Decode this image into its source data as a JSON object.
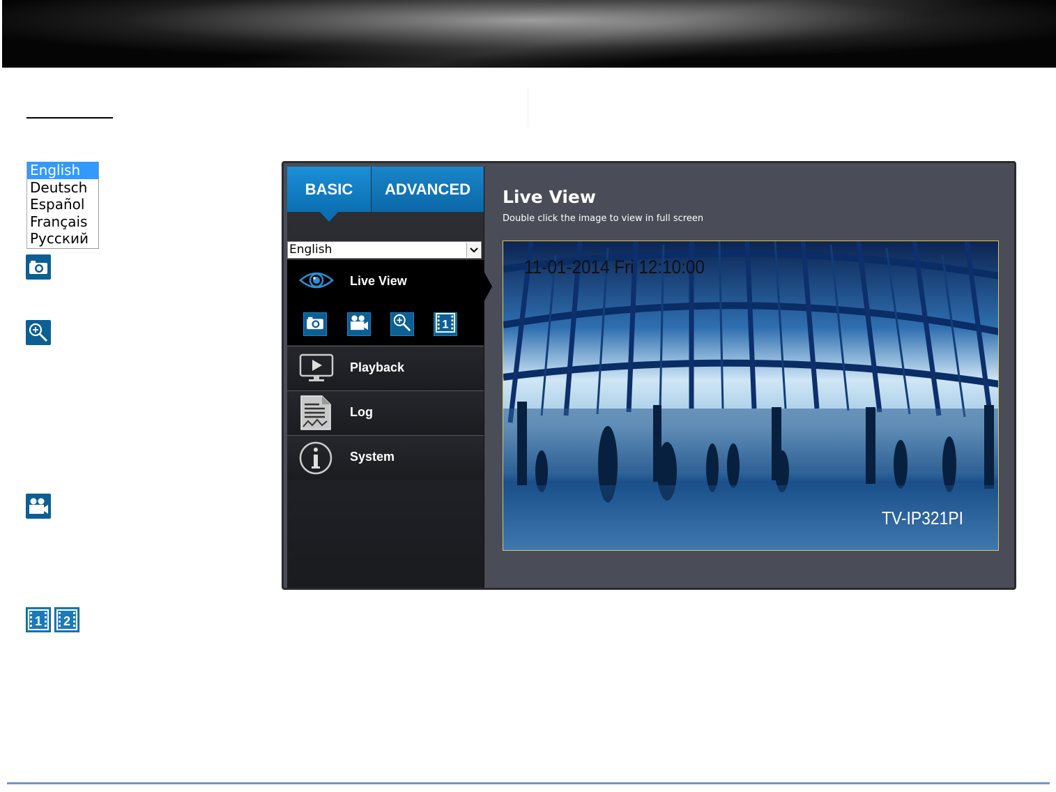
{
  "language_list": {
    "options": [
      "English",
      "Deutsch",
      "Español",
      "Français",
      "Русский"
    ],
    "selected": "English"
  },
  "side_icons": [
    "camera-snapshot-icon",
    "zoom-icon",
    "video-record-icon",
    "stream-1-icon",
    "stream-2-icon"
  ],
  "app": {
    "tabs": {
      "basic": "BASIC",
      "advanced": "ADVANCED"
    },
    "language_select": "English",
    "nav": {
      "live_view": "Live View",
      "playback": "Playback",
      "log": "Log",
      "system": "System"
    },
    "main": {
      "title": "Live View",
      "subtitle": "Double click the image to view in full screen",
      "osd_time": "11-01-2014 Fri 12:10:00",
      "osd_model": "TV-IP321PI"
    }
  },
  "colors": {
    "accent_blue": "#0b6fb3",
    "panel_bg": "#4a4d57",
    "footer_rule": "#6f97c7"
  }
}
